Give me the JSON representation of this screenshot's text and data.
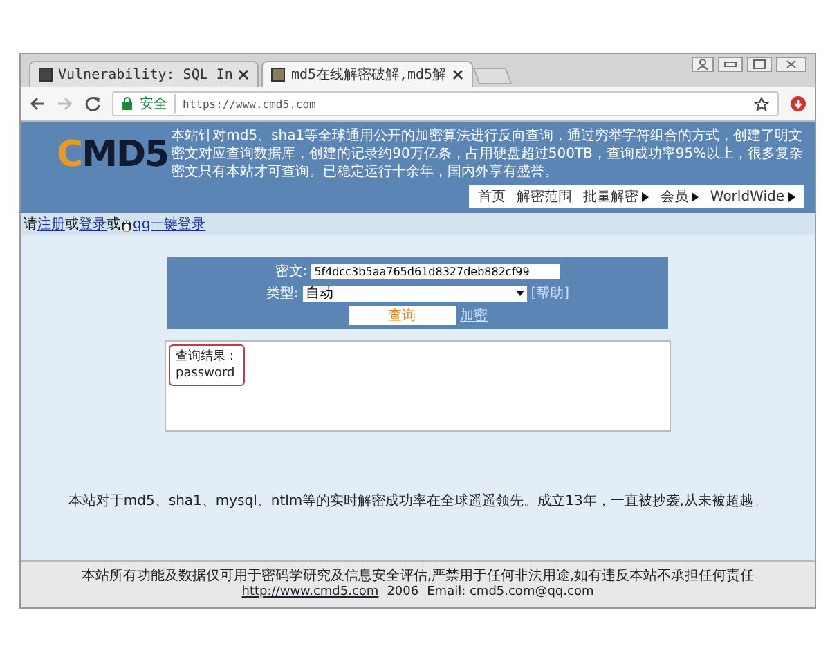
{
  "browser": {
    "tabs": [
      {
        "title": "Vulnerability: SQL In",
        "selected": false
      },
      {
        "title": "md5在线解密破解,md5解",
        "selected": true
      }
    ],
    "security_label": "安全",
    "url": "https://www.cmd5.com"
  },
  "site": {
    "logo": "CMD5",
    "intro": "本站针对md5、sha1等全球通用公开的加密算法进行反向查询，通过穷举字符组合的方式，创建了明文密文对应查询数据库，创建的记录约90万亿条，占用硬盘超过500TB，查询成功率95%以上，很多复杂密文只有本站才可查询。已稳定运行十余年，国内外享有盛誉。",
    "nav": [
      {
        "label": "首页",
        "has_menu": false
      },
      {
        "label": "解密范围",
        "has_menu": false
      },
      {
        "label": "批量解密",
        "has_menu": true
      },
      {
        "label": "会员",
        "has_menu": true
      },
      {
        "label": "WorldWide",
        "has_menu": true
      }
    ],
    "login": {
      "prefix": "请",
      "register": "注册",
      "or_1": "或",
      "login": "登录",
      "or_2": "或",
      "qq_login": "qq一键登录"
    },
    "query_form": {
      "cipher_label": "密文:",
      "cipher_value": "5f4dcc3b5aa765d61d8327deb882cf99",
      "type_label": "类型:",
      "type_value": "自动",
      "help_link": "[帮助]",
      "submit": "查询",
      "encrypt_link": "加密"
    },
    "result": {
      "title": "查询结果：",
      "value": "password",
      "highlighted": true
    },
    "tagline": "本站对于md5、sha1、mysql、ntlm等的实时解密成功率在全球遥遥领先。成立13年，一直被抄袭,从未被超越。",
    "footer": {
      "notice": "本站所有功能及数据仅可用于密码学研究及信息安全评估,严禁用于任何非法用途,如有违反本站不承担任何责任",
      "link": "http://www.cmd5.com",
      "year": "2006",
      "email": "Email: cmd5.com@qq.com"
    }
  }
}
